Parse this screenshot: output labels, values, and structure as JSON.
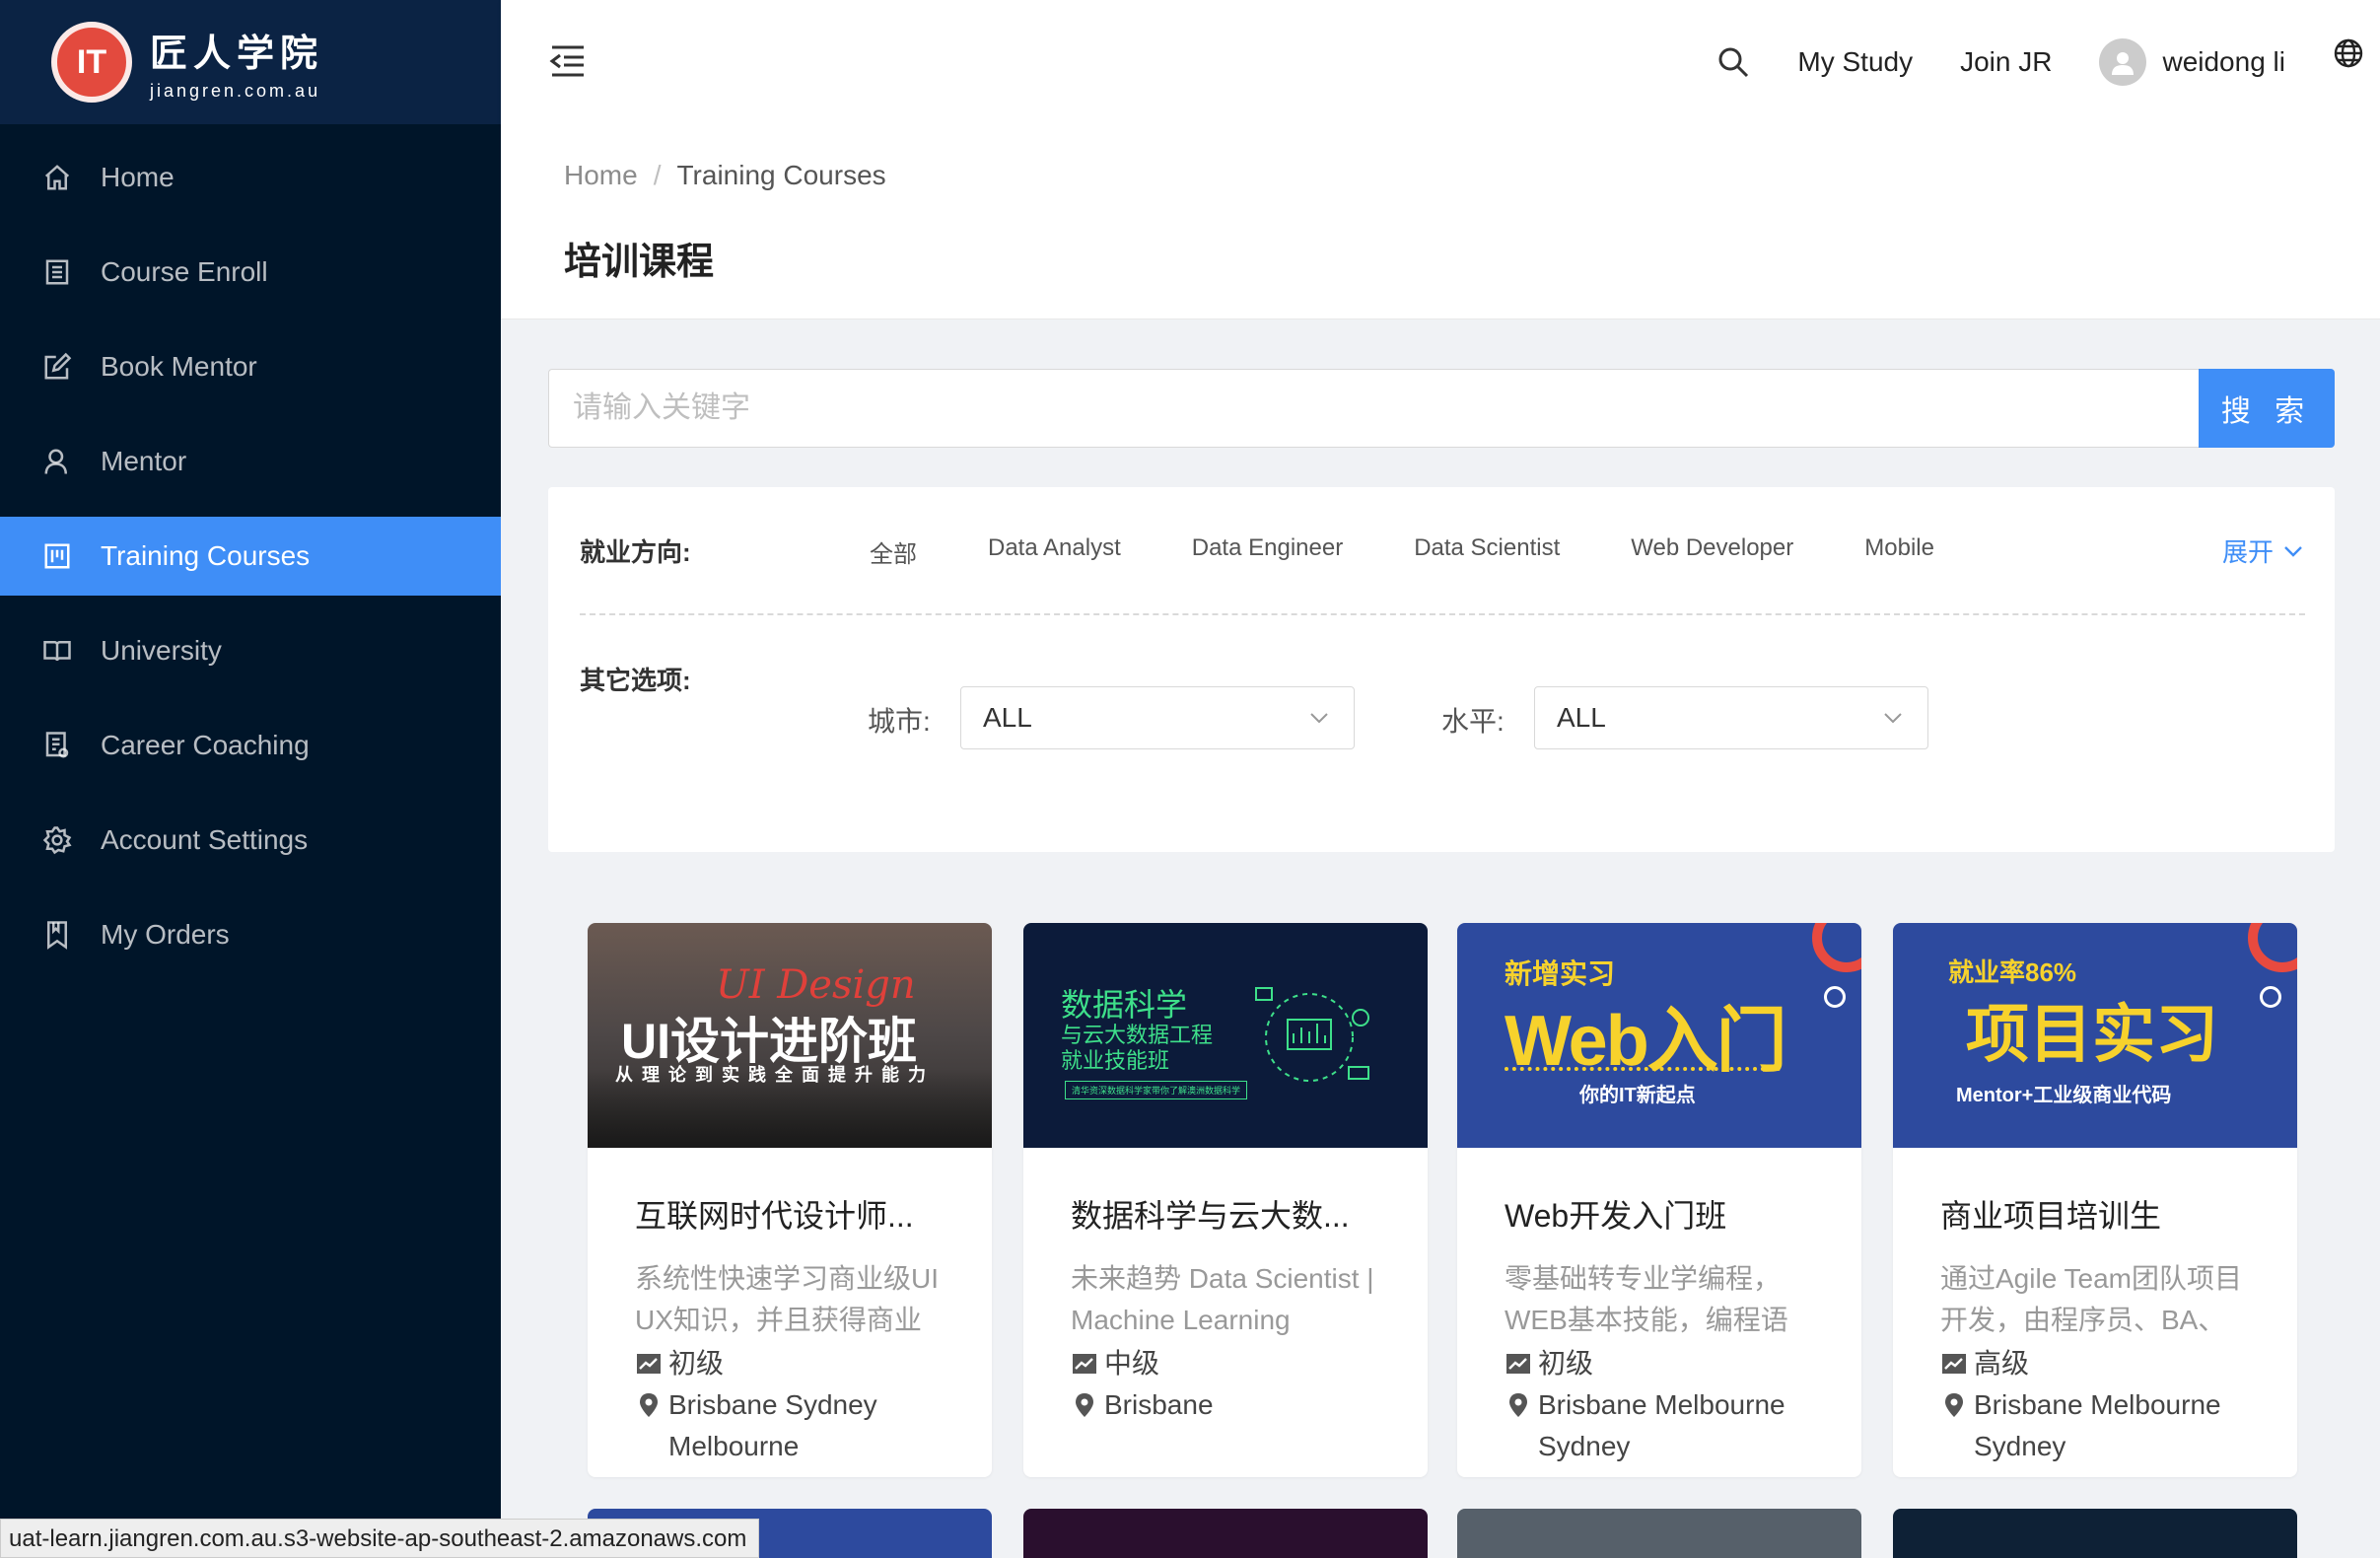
{
  "brand": {
    "cn": "匠人学院",
    "en": "jiangren.com.au",
    "logo_mark": "IT"
  },
  "sidebar": {
    "items": [
      {
        "label": "Home",
        "icon": "home-icon"
      },
      {
        "label": "Course Enroll",
        "icon": "list-icon"
      },
      {
        "label": "Book Mentor",
        "icon": "edit-icon"
      },
      {
        "label": "Mentor",
        "icon": "user-icon"
      },
      {
        "label": "Training Courses",
        "icon": "board-icon",
        "active": true
      },
      {
        "label": "University",
        "icon": "book-icon"
      },
      {
        "label": "Career Coaching",
        "icon": "doc-icon"
      },
      {
        "label": "Account Settings",
        "icon": "gear-icon"
      },
      {
        "label": "My Orders",
        "icon": "bookmark-icon"
      }
    ]
  },
  "header": {
    "my_study": "My Study",
    "join": "Join JR",
    "user": "weidong li"
  },
  "breadcrumb": {
    "home": "Home",
    "sep": "/",
    "current": "Training Courses"
  },
  "page_title": "培训课程",
  "search": {
    "placeholder": "请输入关键字",
    "button": "搜 索"
  },
  "filters": {
    "direction_label": "就业方向:",
    "directions": [
      "全部",
      "Data Analyst",
      "Data Engineer",
      "Data Scientist",
      "Web Developer",
      "Mobile"
    ],
    "expand": "展开",
    "other_label": "其它选项:",
    "city_label": "城市:",
    "city_value": "ALL",
    "level_label": "水平:",
    "level_value": "ALL"
  },
  "courses": [
    {
      "title": "互联网时代设计师...",
      "desc": "系统性快速学习商业级UI UX知识，并且获得商业项目经验，增加面试筹码",
      "level": "初级",
      "cities": "Brisbane Sydney Melbourne",
      "banner": {
        "script": "UI Design",
        "main": "UI设计进阶班",
        "sub": "从 理 论 到 实 践 全 面 提 升 能 力"
      }
    },
    {
      "title": "数据科学与云大数...",
      "desc": "未来趋势 Data Scientist | Machine Learning",
      "level": "中级",
      "cities": "Brisbane",
      "banner": {
        "main": "数据科学",
        "line2": "与云大数据工程",
        "line3": "就业技能班",
        "tag": "清华资深数据科学家带你了解澳洲数据科学"
      }
    },
    {
      "title": "Web开发入门班",
      "desc": "零基础转专业学编程，WEB基本技能，编程语言PHP，世界最流行",
      "level": "初级",
      "cities": "Brisbane Melbourne Sydney",
      "banner": {
        "top": "新增实习",
        "main": "Web入门",
        "sub": "你的IT新起点"
      }
    },
    {
      "title": "商业项目培训生",
      "desc": "通过Agile Team团队项目开发，由程序员、BA、UI、测试组成，完成多个",
      "level": "高级",
      "cities": "Brisbane Melbourne Sydney",
      "banner": {
        "top": "就业率86%",
        "main": "项目实习",
        "sub": "Mentor+工业级商业代码"
      }
    }
  ],
  "status_bar": "uat-learn.jiangren.com.au.s3-website-ap-southeast-2.amazonaws.com",
  "colors": {
    "primary": "#3f8ef7",
    "sidebar": "#001529",
    "sidebar_logo": "#0b2344",
    "banner_blue": "#2d4a9e",
    "banner_yellow": "#f7d22c"
  }
}
